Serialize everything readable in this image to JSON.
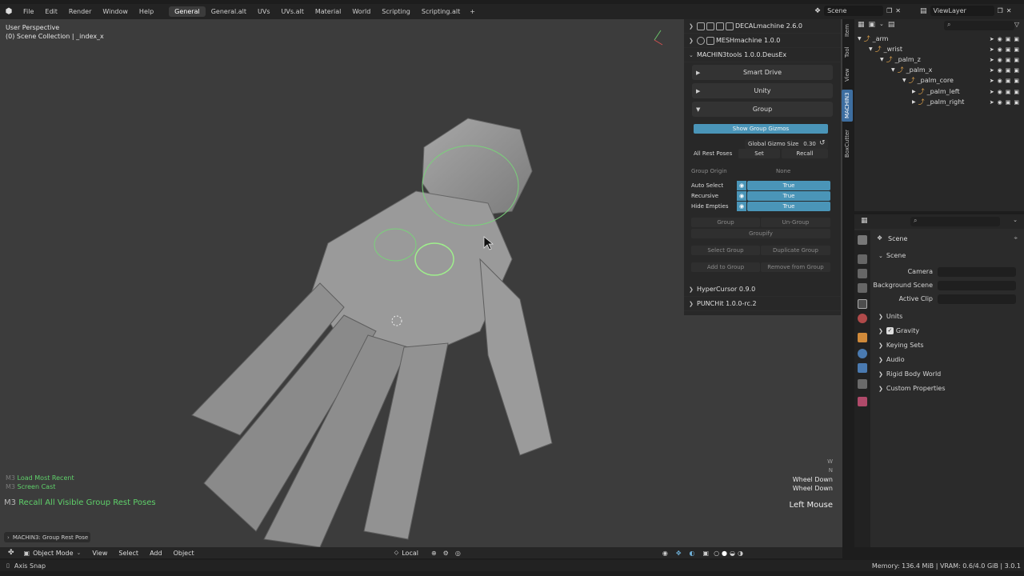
{
  "top_menu": {
    "items": [
      "File",
      "Edit",
      "Render",
      "Window",
      "Help"
    ],
    "workspaces": [
      "General",
      "General.alt",
      "UVs",
      "UVs.alt",
      "Material",
      "World",
      "Scripting",
      "Scripting.alt"
    ],
    "add_workspace": "+",
    "scene_name": "Scene",
    "view_layer": "ViewLayer"
  },
  "viewport": {
    "perspective": "User Perspective",
    "collection": "(0) Scene Collection | _index_x",
    "history": [
      "Load Most Recent",
      "Screen Cast"
    ],
    "history_prefix": "M3",
    "last_op_prefix": "M3",
    "last_op": "Recall All Visible Group Rest Poses",
    "keys": [
      "W",
      "N",
      "Wheel Down",
      "Wheel Down"
    ],
    "mouse": "Left Mouse",
    "redo_panel": "MACHIN3: Group Rest Pose"
  },
  "npanel": {
    "addons": [
      "DECALmachine 2.6.0",
      "MESHmachine 1.0.0",
      "MACHIN3tools 1.0.0.DeusEx"
    ],
    "subpanels": [
      "Smart Drive",
      "Unity",
      "Group"
    ],
    "show_gizmos": "Show Group Gizmos",
    "gizmo_size_label": "Global Gizmo Size",
    "gizmo_size_value": "0.30",
    "rest_poses_label": "All Rest Poses",
    "set_label": "Set",
    "recall_label": "Recall",
    "group_origin_label": "Group Origin",
    "group_origin_value": "None",
    "toggles": [
      {
        "label": "Auto Select",
        "value": "True"
      },
      {
        "label": "Recursive",
        "value": "True"
      },
      {
        "label": "Hide Empties",
        "value": "True"
      }
    ],
    "buttons": {
      "group": "Group",
      "ungroup": "Un-Group",
      "groupify": "Groupify",
      "select_group": "Select Group",
      "duplicate_group": "Duplicate Group",
      "add_to_group": "Add to Group",
      "remove_from_group": "Remove from Group"
    },
    "more_addons": [
      "HyperCursor 0.9.0",
      "PUNCHit 1.0.0-rc.2"
    ]
  },
  "vtabs": [
    "Item",
    "Tool",
    "View",
    "MACHIN3",
    "BoxCutter"
  ],
  "outliner": {
    "rows": [
      {
        "name": "_arm"
      },
      {
        "name": "_wrist"
      },
      {
        "name": "_palm_z"
      },
      {
        "name": "_palm_x"
      },
      {
        "name": "_palm_core"
      },
      {
        "name": "_palm_left"
      },
      {
        "name": "_palm_right"
      }
    ]
  },
  "properties": {
    "breadcrumb": "Scene",
    "section": "Scene",
    "camera_label": "Camera",
    "background_label": "Background Scene",
    "active_clip_label": "Active Clip",
    "panels": [
      "Units",
      "Gravity",
      "Keying Sets",
      "Audio",
      "Rigid Body World",
      "Custom Properties"
    ]
  },
  "bottom": {
    "mode": "Object Mode",
    "menus": [
      "View",
      "Select",
      "Add",
      "Object"
    ],
    "orientation": "Local"
  },
  "status": {
    "left": "Axis Snap",
    "right": "Memory: 136.4 MiB | VRAM: 0.6/4.0 GiB | 3.0.1"
  },
  "colors": {
    "accent_blue": "#4a95b8",
    "active_tab": "#3d6ea0",
    "history_green": "#5fd06a",
    "bone_orange": "#e0a24a"
  }
}
